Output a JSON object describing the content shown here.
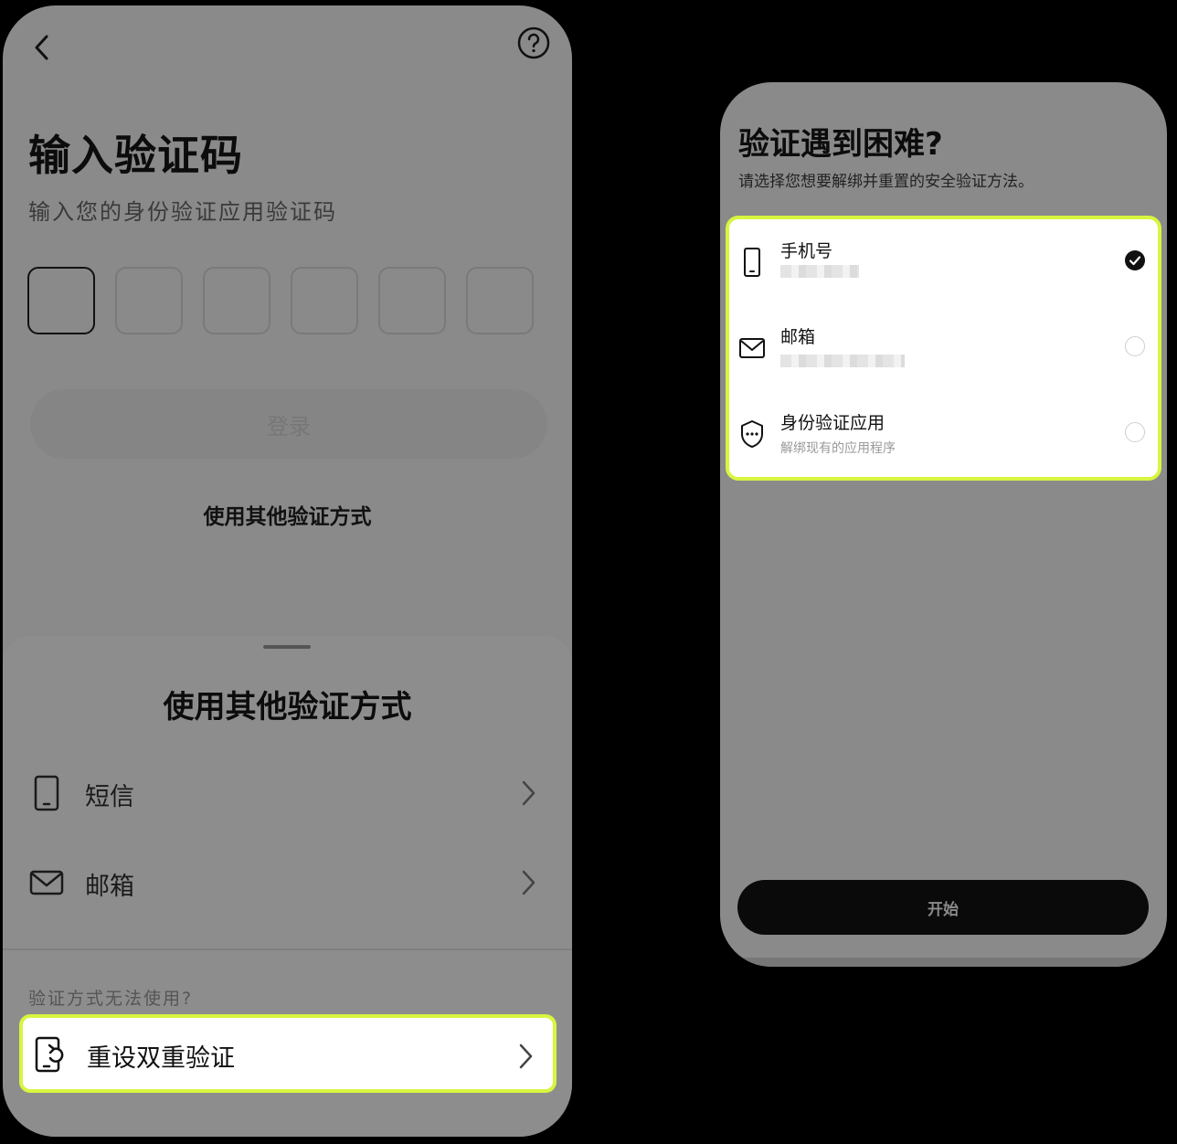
{
  "left_screen": {
    "title": "输入验证码",
    "subtitle": "输入您的身份验证应用验证码",
    "code_boxes": 6,
    "login_label": "登录",
    "other_methods_link": "使用其他验证方式",
    "sheet": {
      "title": "使用其他验证方式",
      "options": [
        {
          "label": "短信",
          "icon": "phone-icon"
        },
        {
          "label": "邮箱",
          "icon": "mail-icon"
        }
      ],
      "cant_use_label": "验证方式无法使用?",
      "reset_label": "重设双重验证",
      "reset_icon": "reset-phone-icon"
    }
  },
  "right_screen": {
    "title": "验证遇到困难?",
    "subtitle": "请选择您想要解绑并重置的安全验证方法。",
    "options": [
      {
        "label": "手机号",
        "detail": "",
        "icon": "phone-icon",
        "selected": true
      },
      {
        "label": "邮箱",
        "detail": "",
        "icon": "mail-icon",
        "selected": false
      },
      {
        "label": "身份验证应用",
        "detail": "解绑现有的应用程序",
        "icon": "shield-icon",
        "selected": false
      }
    ],
    "start_label": "开始"
  },
  "colors": {
    "highlight": "#d8f53f",
    "overlay": "#8a8a8a",
    "button_dark": "#0a0a0a"
  }
}
